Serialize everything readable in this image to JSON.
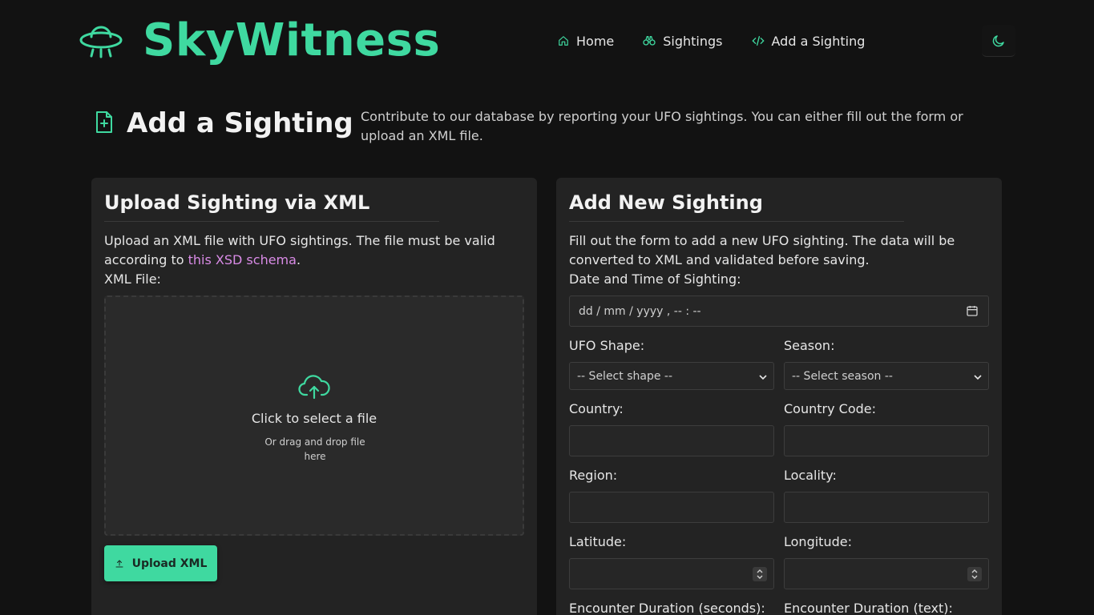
{
  "brand": {
    "name": "SkyWitness"
  },
  "nav": {
    "items": [
      {
        "label": "Home",
        "icon": "home-icon"
      },
      {
        "label": "Sightings",
        "icon": "binoculars-icon"
      },
      {
        "label": "Add a Sighting",
        "icon": "code-icon"
      }
    ],
    "theme_toggle_icon": "moon-icon"
  },
  "page": {
    "title": "Add a Sighting",
    "description": "Contribute to our database by reporting your UFO sightings. You can either fill out the form or upload an XML file."
  },
  "upload_card": {
    "title": "Upload Sighting via XML",
    "text_before": "Upload an XML file with UFO sightings. The file must be valid according to ",
    "link_text": "this XSD schema",
    "text_after": ".",
    "file_label": "XML File:",
    "drop_main": "Click to select a file",
    "drop_sub": "Or drag and drop file here",
    "button_label": "Upload XML"
  },
  "form_card": {
    "title": "Add New Sighting",
    "intro": "Fill out the form to add a new UFO sighting. The data will be converted to XML and validated before saving.",
    "datetime_label": "Date and Time of Sighting:",
    "datetime_placeholder": "dd / mm / yyyy ,  -- : --",
    "shape_label": "UFO Shape:",
    "shape_value": "-- Select shape --",
    "season_label": "Season:",
    "season_value": "-- Select season --",
    "country_label": "Country:",
    "country_code_label": "Country Code:",
    "region_label": "Region:",
    "locality_label": "Locality:",
    "latitude_label": "Latitude:",
    "longitude_label": "Longitude:",
    "duration_seconds_label": "Encounter Duration (seconds):",
    "duration_text_label": "Encounter Duration (text):"
  },
  "colors": {
    "accent": "#3fd9a0",
    "link": "#d98be6",
    "background": "#121212",
    "card": "#232323"
  }
}
